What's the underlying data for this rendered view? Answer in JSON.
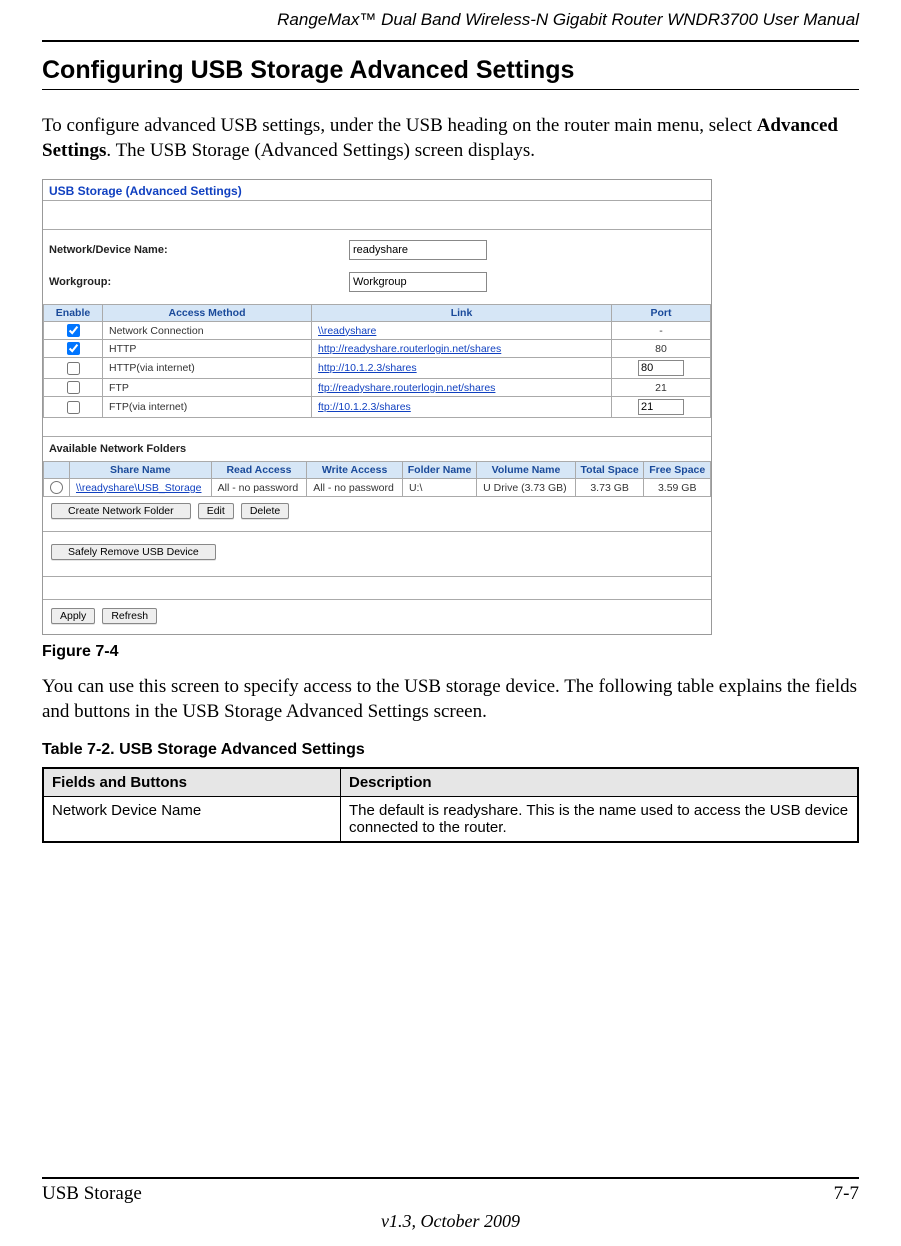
{
  "header": {
    "running": "RangeMax™ Dual Band Wireless-N Gigabit Router WNDR3700 User Manual"
  },
  "section": {
    "title": "Configuring USB Storage Advanced Settings",
    "intro_prefix": "To configure advanced USB settings, under the USB heading on the router main menu, select ",
    "intro_bold": "Advanced Settings",
    "intro_suffix": ". The USB Storage (Advanced Settings) screen displays.",
    "after_figure": "You can use this screen to specify access to the USB storage device. The following table explains the fields and buttons in the USB Storage Advanced Settings screen."
  },
  "figure": {
    "caption": "Figure 7-4"
  },
  "screenshot": {
    "panel_title": "USB Storage (Advanced Settings)",
    "labels": {
      "device_name": "Network/Device Name:",
      "workgroup": "Workgroup:"
    },
    "values": {
      "device_name": "readyshare",
      "workgroup": "Workgroup"
    },
    "table1": {
      "headers": {
        "enable": "Enable",
        "method": "Access Method",
        "link": "Link",
        "port": "Port"
      },
      "rows": [
        {
          "checked": true,
          "method": "Network Connection",
          "link": "\\\\readyshare",
          "port_text": "-",
          "port_input": null
        },
        {
          "checked": true,
          "method": "HTTP",
          "link": "http://readyshare.routerlogin.net/shares",
          "port_text": "80",
          "port_input": null
        },
        {
          "checked": false,
          "method": "HTTP(via internet)",
          "link": "http://10.1.2.3/shares",
          "port_text": null,
          "port_input": "80"
        },
        {
          "checked": false,
          "method": "FTP",
          "link": "ftp://readyshare.routerlogin.net/shares",
          "port_text": "21",
          "port_input": null
        },
        {
          "checked": false,
          "method": "FTP(via internet)",
          "link": "ftp://10.1.2.3/shares",
          "port_text": null,
          "port_input": "21"
        }
      ]
    },
    "folders_label": "Available Network Folders",
    "table2": {
      "headers": {
        "share": "Share Name",
        "read": "Read Access",
        "write": "Write Access",
        "folder": "Folder Name",
        "volume": "Volume Name",
        "total": "Total Space",
        "free": "Free Space"
      },
      "row": {
        "share": "\\\\readyshare\\USB_Storage",
        "read": "All - no password",
        "write": "All - no password",
        "folder": "U:\\",
        "volume": "U Drive (3.73 GB)",
        "total": "3.73 GB",
        "free": "3.59 GB"
      }
    },
    "buttons": {
      "create": "Create Network Folder",
      "edit": "Edit",
      "delete": "Delete",
      "safely_remove": "Safely Remove USB Device",
      "apply": "Apply",
      "refresh": "Refresh"
    }
  },
  "desc_table": {
    "caption": "Table 7-2.  USB Storage Advanced Settings",
    "headers": {
      "a": "Fields and Buttons",
      "b": "Description"
    },
    "rows": [
      {
        "a": "Network Device Name",
        "b": "The default is readyshare. This is the name used to access the USB device connected to the router."
      }
    ]
  },
  "footer": {
    "left": "USB Storage",
    "right": "7-7",
    "version": "v1.3, October 2009"
  }
}
